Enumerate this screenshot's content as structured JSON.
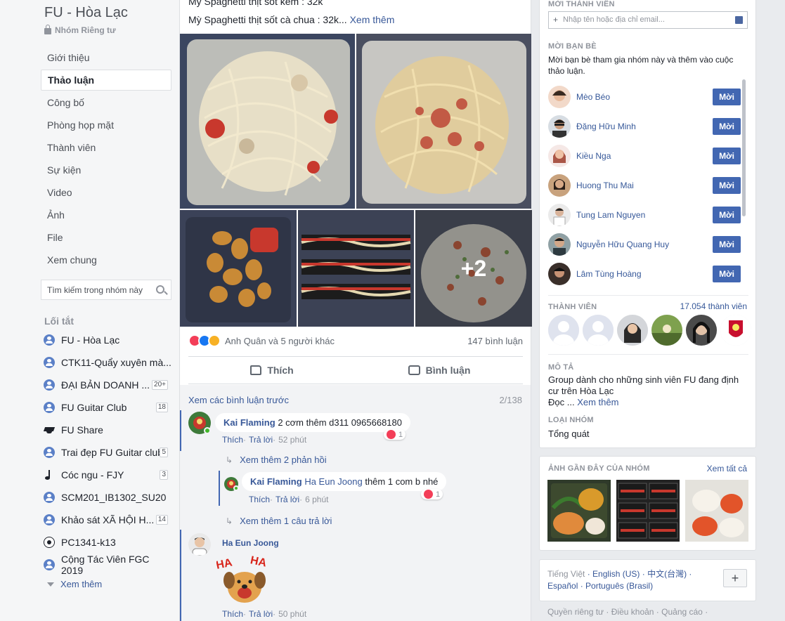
{
  "group": {
    "title": "FU - Hòa Lạc",
    "privacy": "Nhóm Riêng tư"
  },
  "nav": [
    {
      "label": "Giới thiệu",
      "active": false
    },
    {
      "label": "Thảo luận",
      "active": true
    },
    {
      "label": "Công bố",
      "active": false
    },
    {
      "label": "Phòng họp mặt",
      "active": false
    },
    {
      "label": "Thành viên",
      "active": false
    },
    {
      "label": "Sự kiện",
      "active": false
    },
    {
      "label": "Video",
      "active": false
    },
    {
      "label": "Ảnh",
      "active": false
    },
    {
      "label": "File",
      "active": false
    },
    {
      "label": "Xem chung",
      "active": false
    }
  ],
  "search": {
    "placeholder": "Tìm kiếm trong nhóm này"
  },
  "shortcuts": {
    "title": "Lối tắt",
    "items": [
      {
        "label": "FU - Hòa Lạc",
        "icon": "group-icon",
        "badge": ""
      },
      {
        "label": "CTK11-Quẩy xuyên mà...",
        "icon": "group-icon",
        "badge": ""
      },
      {
        "label": "ĐẠI BẢN DOANH ...",
        "icon": "group-icon",
        "badge": "20+"
      },
      {
        "label": "FU Guitar Club",
        "icon": "group-icon",
        "badge": "18"
      },
      {
        "label": "FU Share",
        "icon": "graduation-cap-icon",
        "badge": ""
      },
      {
        "label": "Trai đẹp FU Guitar club",
        "icon": "group-icon",
        "badge": "5"
      },
      {
        "label": "Cóc ngu - FJY",
        "icon": "music-note-icon",
        "badge": "3"
      },
      {
        "label": "SCM201_IB1302_SU20",
        "icon": "group-icon",
        "badge": ""
      },
      {
        "label": "Khảo sát XÃ HỘI H...",
        "icon": "group-icon",
        "badge": "14"
      },
      {
        "label": "PC1341-k13",
        "icon": "soccer-ball-icon",
        "badge": ""
      },
      {
        "label": "Cộng Tác Viên FGC 2019",
        "icon": "group-icon",
        "badge": ""
      }
    ],
    "more": "Xem thêm"
  },
  "post": {
    "line1": "Mỳ Spaghetti thịt sốt kem : 32k",
    "line2": "Mỳ Spaghetti thịt sốt cà chua : 32k...",
    "see_more": "Xem thêm",
    "more_photos": "+2",
    "reaction_names": "Anh Quân và 5 người khác",
    "comment_count": "147 bình luận",
    "like": "Thích",
    "comment": "Bình luận"
  },
  "comments": {
    "previous": "Xem các bình luận trước",
    "page": "2/138",
    "c1": {
      "author": "Kai Flaming",
      "text": "2 cơm thêm d311 0965668180",
      "like": "Thích",
      "reply": "Trả lời",
      "time": "52 phút",
      "reacts": "1",
      "more_replies": "Xem thêm 2 phản hồi"
    },
    "c2": {
      "author": "Kai Flaming",
      "mention": "Ha Eun Joong",
      "text": "thêm 1 com b nhé",
      "like": "Thích",
      "reply": "Trả lời",
      "time": "6 phút",
      "reacts": "1",
      "more_replies": "Xem thêm 1 câu trả lời"
    },
    "c3": {
      "author": "Ha Eun Joong",
      "like": "Thích",
      "reply": "Trả lời",
      "time": "50 phút"
    }
  },
  "right": {
    "invite_title": "Mời thành viên",
    "invite_placeholder": "Nhập tên hoặc địa chỉ email...",
    "friends_title": "Mời bạn bè",
    "friends_desc": "Mời bạn bè tham gia nhóm này và thêm vào cuộc thảo luận.",
    "invite_label": "Mời",
    "friends": [
      {
        "name": "Mèo Béo"
      },
      {
        "name": "Đặng Hữu Minh"
      },
      {
        "name": "Kiều Nga"
      },
      {
        "name": "Huong Thu Mai"
      },
      {
        "name": "Tung Lam Nguyen"
      },
      {
        "name": "Nguyễn Hữu Quang Huy"
      },
      {
        "name": "Lâm Tùng Hoàng"
      }
    ],
    "members_title": "Thành viên",
    "members_count": "17.054 thành viên",
    "desc_title": "Mô tả",
    "desc_text": "Group dành cho những sinh viên FU đang định cư trên Hòa Lạc",
    "desc_more_prefix": "Đọc ...",
    "desc_more": "Xem thêm",
    "type_title": "Loại nhóm",
    "type_value": "Tổng quát",
    "photos_title": "Ảnh gần đây của nhóm",
    "photos_all": "Xem tất cả",
    "languages": {
      "current": "Tiếng Việt",
      "others": [
        "English (US)",
        "中文(台灣)",
        "Español",
        "Português (Brasil)"
      ]
    },
    "footer": [
      "Quyền riêng tư",
      "Điều khoản",
      "Quảng cáo"
    ]
  }
}
